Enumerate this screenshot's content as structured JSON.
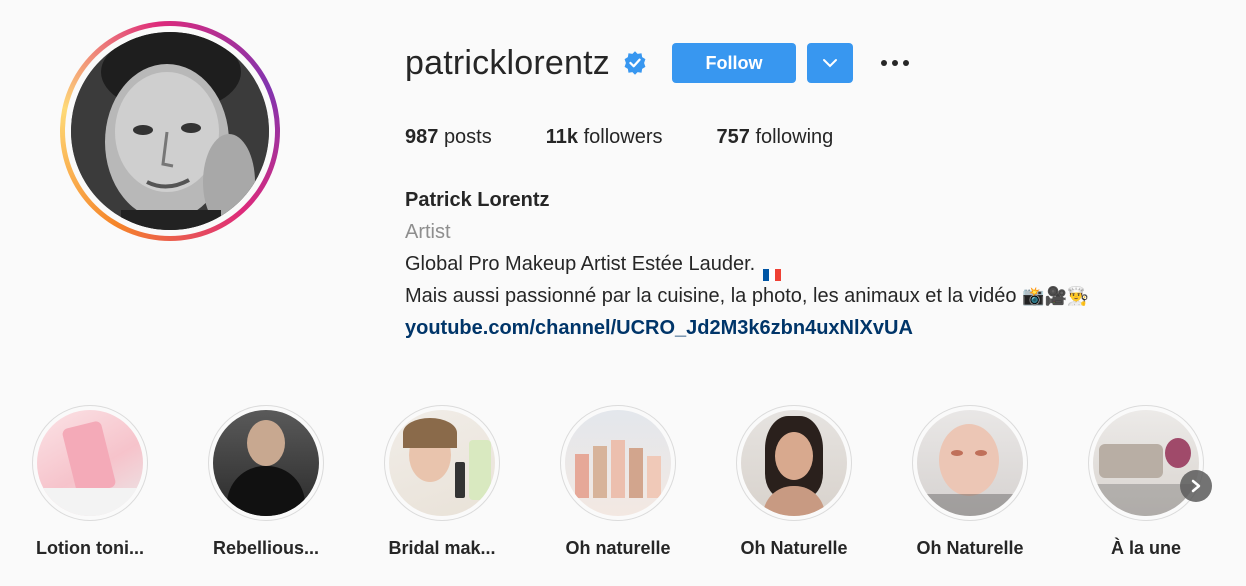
{
  "profile": {
    "username": "patricklorentz",
    "verified_icon": "verified-badge-icon",
    "follow_label": "Follow",
    "dropdown_icon": "chevron-down-icon",
    "more_icon": "more-options-icon"
  },
  "stats": {
    "posts_count": "987",
    "posts_label": "posts",
    "followers_count": "11k",
    "followers_label": "followers",
    "following_count": "757",
    "following_label": "following"
  },
  "bio": {
    "name": "Patrick Lorentz",
    "category": "Artist",
    "line1": "Global Pro Makeup Artist Estée Lauder.",
    "line2": "Mais aussi passionné par la cuisine, la photo, les animaux et la vidéo",
    "line2_emoji": "📸🎥👨‍🍳",
    "link": "youtube.com/channel/UCRO_Jd2M3k6zbn4uxNlXvUA"
  },
  "highlights": [
    {
      "label": "Lotion toni..."
    },
    {
      "label": "Rebellious..."
    },
    {
      "label": "Bridal mak..."
    },
    {
      "label": "Oh naturelle"
    },
    {
      "label": "Oh Naturelle"
    },
    {
      "label": "Oh Naturelle"
    },
    {
      "label": "À la une"
    }
  ],
  "colors": {
    "accent": "#3897f0",
    "link": "#003569",
    "muted": "#8e8e8e"
  }
}
